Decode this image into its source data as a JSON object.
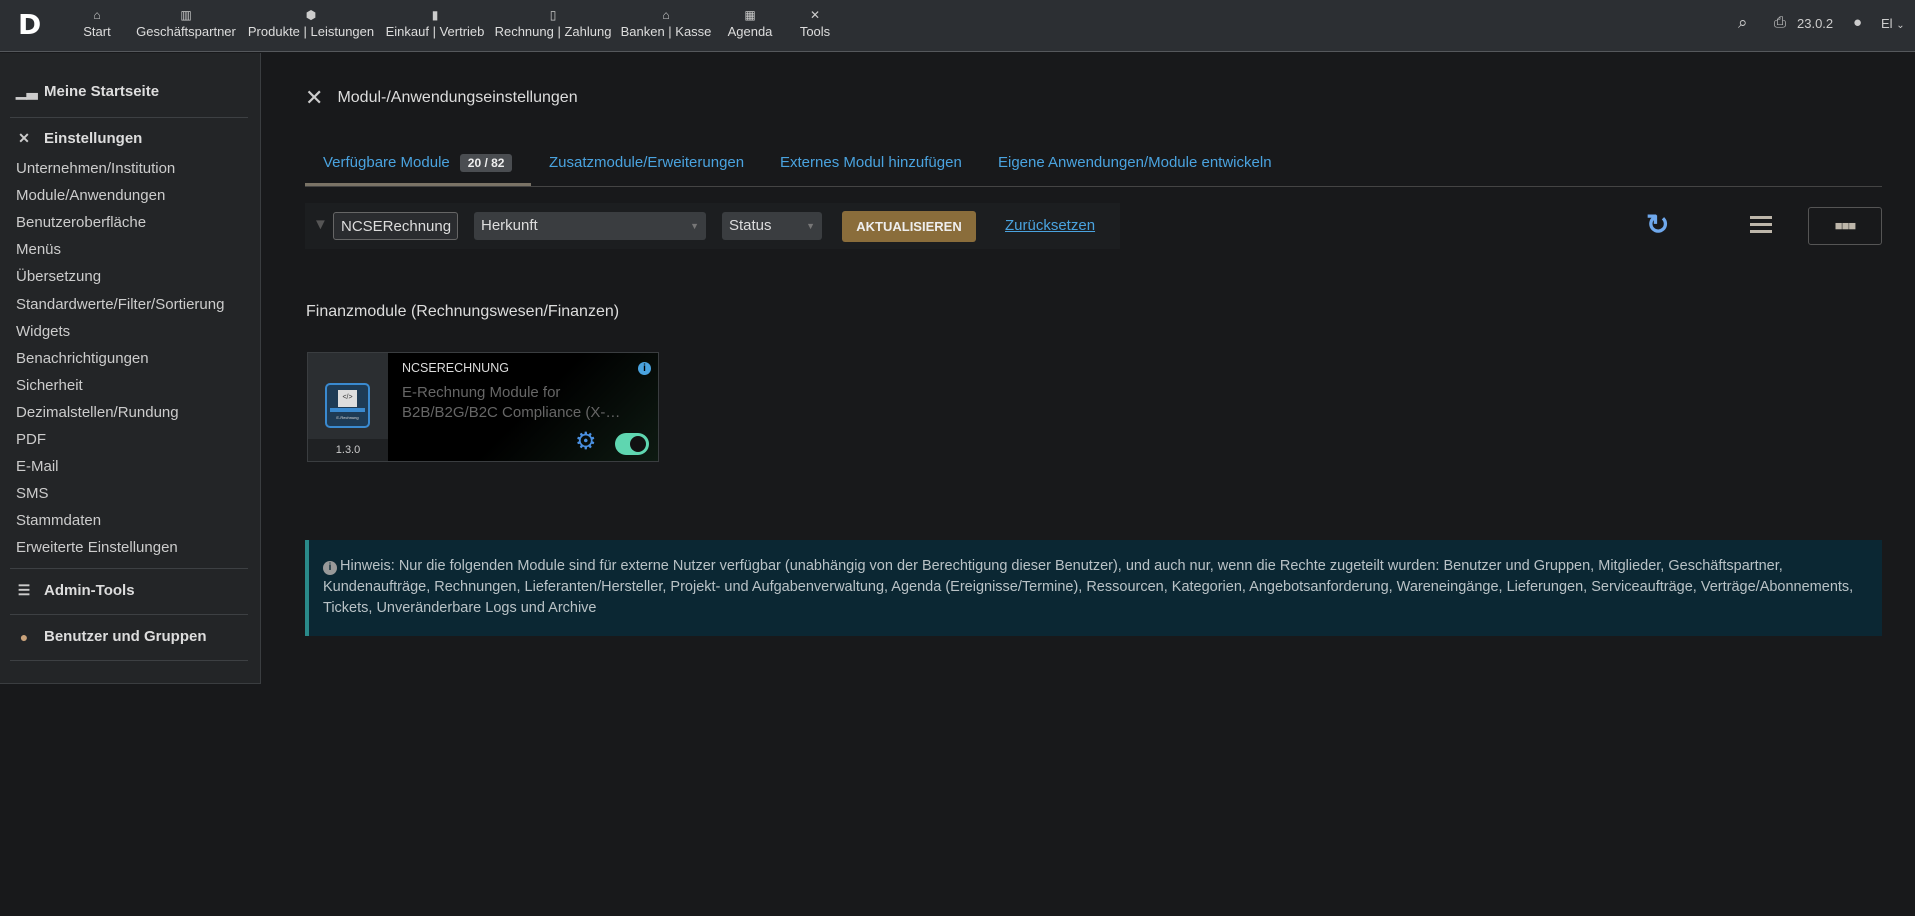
{
  "nav": {
    "logo": "D",
    "items": [
      {
        "label": "Start",
        "icon": "home-icon",
        "glyph": "⌂"
      },
      {
        "label": "Geschäftspartner",
        "icon": "building-icon",
        "glyph": "▥"
      },
      {
        "label": "Produkte | Leistungen",
        "icon": "cube-icon",
        "glyph": "⬢"
      },
      {
        "label": "Einkauf | Vertrieb",
        "icon": "briefcase-icon",
        "glyph": "▮"
      },
      {
        "label": "Rechnung | Zahlung",
        "icon": "invoice-icon",
        "glyph": "▯"
      },
      {
        "label": "Banken | Kasse",
        "icon": "bank-icon",
        "glyph": "⌂"
      },
      {
        "label": "Agenda",
        "icon": "calendar-icon",
        "glyph": "▦"
      },
      {
        "label": "Tools",
        "icon": "tools-icon",
        "glyph": "✕"
      }
    ],
    "version": "23.0.2",
    "user": "El"
  },
  "sidebar": {
    "home": "Meine Startseite",
    "settings": "Einstellungen",
    "items": [
      "Unternehmen/Institution",
      "Module/Anwendungen",
      "Benutzeroberfläche",
      "Menüs",
      "Übersetzung",
      "Standardwerte/Filter/Sortierung",
      "Widgets",
      "Benachrichtigungen",
      "Sicherheit",
      "Dezimalstellen/Rundung",
      "PDF",
      "E-Mail",
      "SMS",
      "Stammdaten",
      "Erweiterte Einstellungen"
    ],
    "admin": "Admin-Tools",
    "users": "Benutzer und Gruppen"
  },
  "page": {
    "title": "Modul-/Anwendungseinstellungen",
    "tabs": [
      {
        "label": "Verfügbare Module",
        "badge": "20 / 82"
      },
      {
        "label": "Zusatzmodule/Erweiterungen"
      },
      {
        "label": "Externes Modul hinzufügen"
      },
      {
        "label": "Eigene Anwendungen/Module entwickeln"
      }
    ],
    "filter": {
      "search": "NCSERechnung",
      "origin": "Herkunft",
      "status": "Status",
      "update": "AKTUALISIEREN",
      "reset": "Zurücksetzen"
    },
    "section": "Finanzmodule (Rechnungswesen/Finanzen)",
    "module": {
      "name": "NCSERECHNUNG",
      "description": "E-Rechnung Module for B2B/B2G/B2C Compliance (X-…",
      "version": "1.3.0",
      "enabled": true,
      "logo_text": "E-Rechnung"
    },
    "hint": "Hinweis: Nur die folgenden Module sind für externe Nutzer verfügbar (unabhängig von der Berechtigung dieser Benutzer), und auch nur, wenn die Rechte zugeteilt wurden: Benutzer und Gruppen, Mitglieder, Geschäftspartner, Kundenaufträge, Rechnungen, Lieferanten/Hersteller, Projekt- und Aufgabenverwaltung, Agenda (Ereignisse/Termine), Ressourcen, Kategorien, Angebotsanforderung, Wareneingänge, Lieferungen, Serviceaufträge, Verträge/Abonnements, Tickets, Unveränderbare Logs und Archive"
  },
  "colors": {
    "accent": "#4aa3df",
    "button": "#8a6d3b",
    "toggle": "#5fd6b0"
  }
}
